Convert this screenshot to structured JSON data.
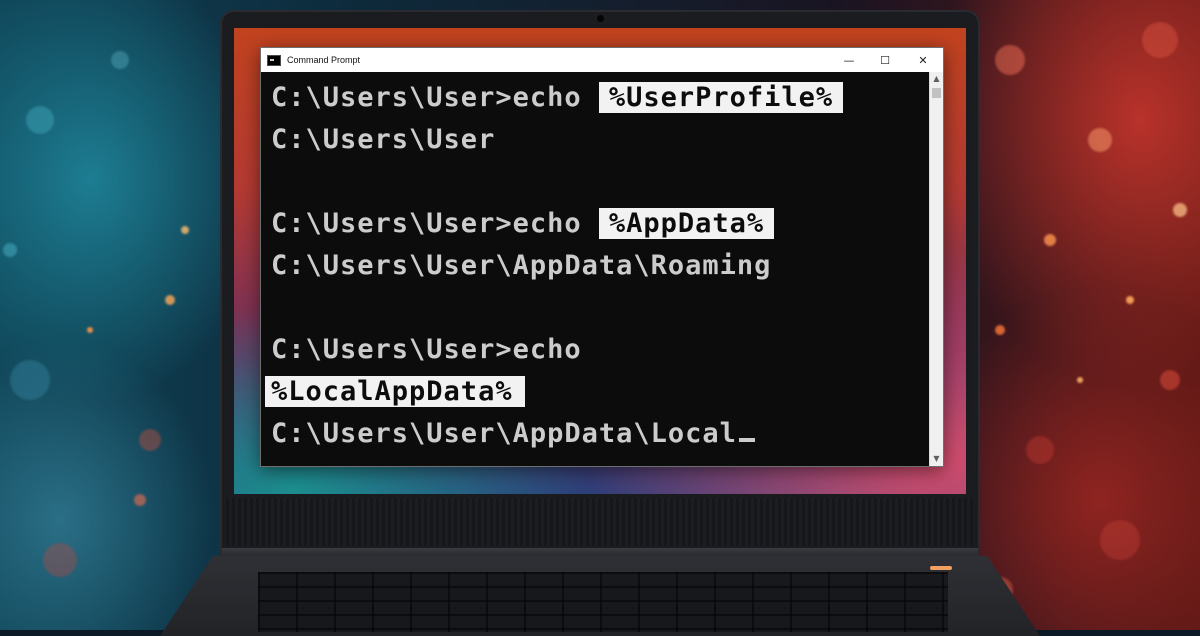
{
  "window": {
    "title": "Command Prompt",
    "controls": {
      "minimize": "—",
      "maximize": "☐",
      "close": "✕"
    }
  },
  "terminal": {
    "lines": [
      {
        "prompt": "C:\\Users\\User>echo ",
        "highlight": "%UserProfile%"
      },
      {
        "text": "C:\\Users\\User"
      },
      {
        "text": ""
      },
      {
        "prompt": "C:\\Users\\User>echo ",
        "highlight": "%AppData%"
      },
      {
        "text": "C:\\Users\\User\\AppData\\Roaming"
      },
      {
        "text": ""
      },
      {
        "text": "C:\\Users\\User>echo"
      },
      {
        "highlight": "%LocalAppData%"
      },
      {
        "text": "C:\\Users\\User\\AppData\\Local"
      }
    ]
  },
  "scrollbar": {
    "up": "▲",
    "down": "▼"
  },
  "colors": {
    "terminal_bg": "#0c0c0c",
    "terminal_text": "#cccccc",
    "highlight_bg": "#f2f2f2",
    "titlebar_bg": "#ffffff"
  }
}
